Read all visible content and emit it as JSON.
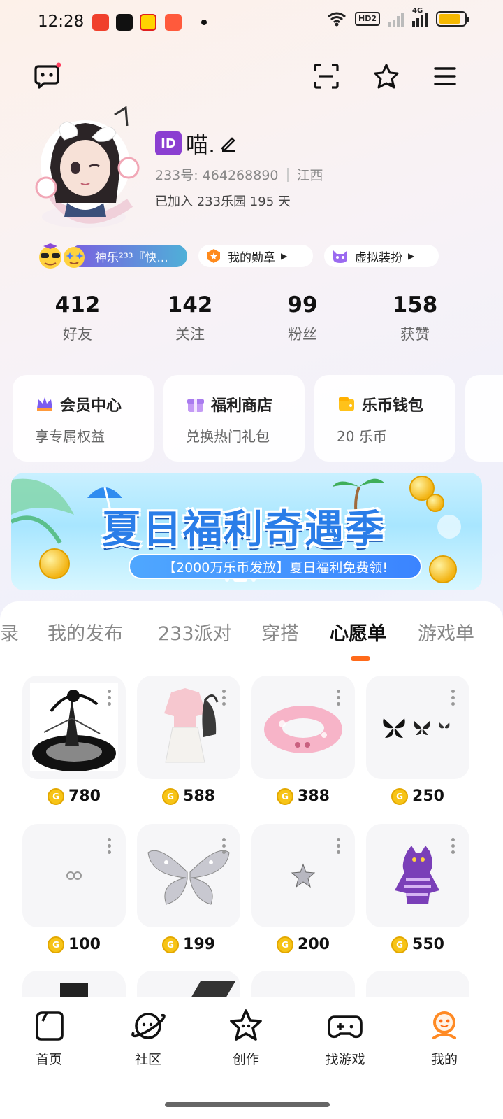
{
  "status_bar": {
    "time": "12:28",
    "apps": [
      {
        "name": "video-app-icon",
        "color": "#f0402c"
      },
      {
        "name": "tiktok-icon",
        "color": "#111111"
      },
      {
        "name": "weibo-icon",
        "color": "#ffd400"
      },
      {
        "name": "taobao-icon",
        "color": "#ff5a3c"
      }
    ],
    "hd_label": "HD2",
    "network_label": "4G",
    "battery_level": 0.85
  },
  "profile": {
    "id_badge": "ID",
    "name": "喵.",
    "account_label": "233号: 464268890",
    "region": "江西",
    "joined": "已加入 233乐园 195 天"
  },
  "badges": {
    "title_pill": "神乐²³³『快...",
    "medals": "我的勋章",
    "avatar_dress": "虚拟装扮"
  },
  "stats": [
    {
      "value": "412",
      "label": "好友"
    },
    {
      "value": "142",
      "label": "关注"
    },
    {
      "value": "99",
      "label": "粉丝"
    },
    {
      "value": "158",
      "label": "获赞"
    }
  ],
  "feature_cards": [
    {
      "title": "会员中心",
      "subtitle": "享专属权益"
    },
    {
      "title": "福利商店",
      "subtitle": "兑换热门礼包"
    },
    {
      "title": "乐币钱包",
      "subtitle": "20 乐币"
    }
  ],
  "banner": {
    "title": "夏日福利奇遇季",
    "subtitle": "【2000万乐币发放】夏日福利免费领!"
  },
  "tabs": [
    "录",
    "我的发布",
    "233派对",
    "穿搭",
    "心愿单",
    "游戏单"
  ],
  "wishlist": [
    {
      "price": "780",
      "icon": "bw-art-figure"
    },
    {
      "price": "588",
      "icon": "pink-dress-outfit"
    },
    {
      "price": "388",
      "icon": "pink-float-ring"
    },
    {
      "price": "250",
      "icon": "butterflies"
    },
    {
      "price": "100",
      "icon": "tiny-charm"
    },
    {
      "price": "199",
      "icon": "silver-butterfly-wings"
    },
    {
      "price": "200",
      "icon": "silver-star"
    },
    {
      "price": "550",
      "icon": "purple-cat-hoodie"
    }
  ],
  "coin_symbol": "G",
  "bottom_nav": [
    {
      "label": "首页"
    },
    {
      "label": "社区"
    },
    {
      "label": "创作"
    },
    {
      "label": "找游戏"
    },
    {
      "label": "我的"
    }
  ]
}
